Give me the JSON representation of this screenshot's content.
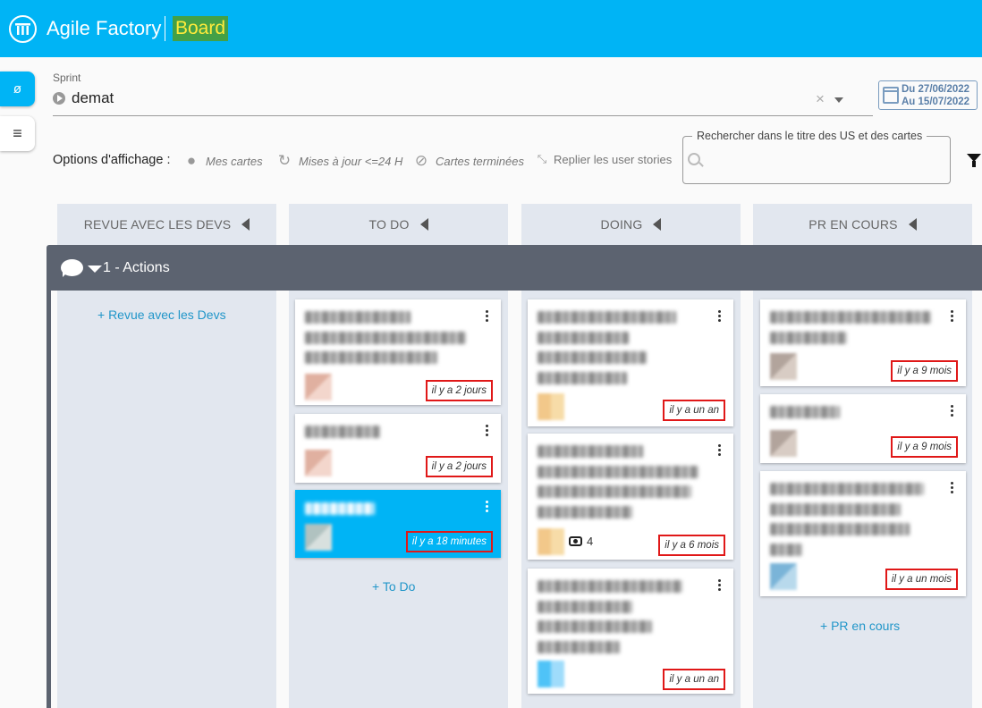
{
  "header": {
    "app_title": "Agile Factory",
    "board_label": "Board",
    "brand_color": "#00b4f5"
  },
  "sidebar": {
    "sync_icon": "sync-icon",
    "menu_icon": "menu-icon"
  },
  "sprint": {
    "label": "Sprint",
    "value": "demat",
    "date_from": "Du 27/06/2022",
    "date_to": "Au 15/07/2022"
  },
  "options": {
    "label": "Options d'affichage :",
    "my_cards": "Mes cartes",
    "updated_recently": "Mises à jour <=24 H",
    "finished_cards": "Cartes terminées",
    "collapse_stories": "Replier les user stories"
  },
  "search": {
    "legend": "Rechercher dans le titre des US et des cartes",
    "placeholder": ""
  },
  "columns": [
    {
      "title": "REVUE AVEC LES DEVS",
      "add_label": "+ Revue avec les Devs"
    },
    {
      "title": "TO DO",
      "add_label": "+ To Do"
    },
    {
      "title": "DOING",
      "add_label": ""
    },
    {
      "title": "PR EN COURS",
      "add_label": "+ PR en cours"
    }
  ],
  "swimlane": {
    "title": "1 - Actions"
  },
  "cards": {
    "todo": [
      {
        "time": "il y a 2 jours",
        "active": false
      },
      {
        "time": "il y a 2 jours",
        "active": false
      },
      {
        "time": "il y a 18 minutes",
        "active": true
      }
    ],
    "doing": [
      {
        "time": "il y a un an"
      },
      {
        "time": "il y a 6 mois",
        "watchers": "4"
      },
      {
        "time": "il y a un an"
      }
    ],
    "pr": [
      {
        "time": "il y a 9 mois"
      },
      {
        "time": "il y a 9 mois"
      },
      {
        "time": "il y a un mois"
      }
    ]
  },
  "colors": {
    "accent": "#00b4f5",
    "board_badge_bg": "#43a047",
    "board_badge_text": "#ffeb3b",
    "swimlane": "#5c6370",
    "column_bg": "#e2e7ef",
    "highlight_border": "#e01818"
  }
}
